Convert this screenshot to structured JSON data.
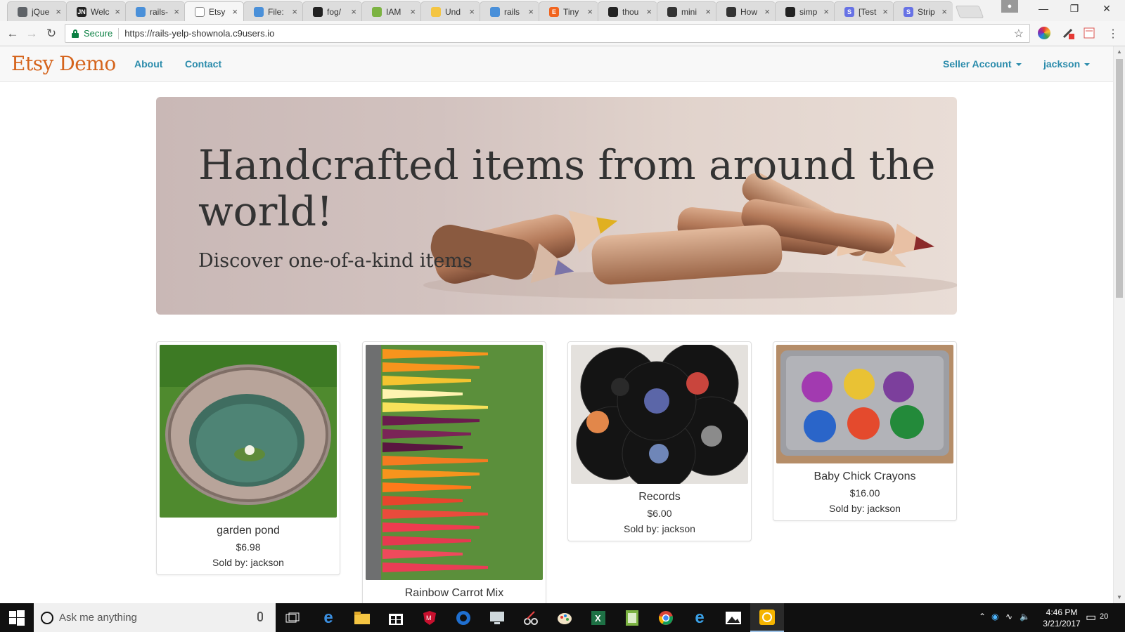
{
  "browser": {
    "tabs": [
      {
        "label": "jQue",
        "icon": "globe-icon",
        "color": "#5f6368",
        "glyph": ""
      },
      {
        "label": "Welc",
        "icon": "jn-icon",
        "color": "#222222",
        "glyph": "JN"
      },
      {
        "label": "rails-",
        "icon": "cloud9-icon",
        "color": "#4a90d9",
        "glyph": ""
      },
      {
        "label": "Etsy",
        "icon": "page-icon",
        "color": "#ffffff",
        "glyph": "",
        "active": true
      },
      {
        "label": "File:",
        "icon": "pencil-icon",
        "color": "#4a90d9",
        "glyph": ""
      },
      {
        "label": "fog/",
        "icon": "github-icon",
        "color": "#222222",
        "glyph": ""
      },
      {
        "label": "IAM",
        "icon": "pin-icon",
        "color": "#7cb342",
        "glyph": ""
      },
      {
        "label": "Und",
        "icon": "box-icon",
        "color": "#f4c542",
        "glyph": ""
      },
      {
        "label": "rails",
        "icon": "cloud9-icon",
        "color": "#4a90d9",
        "glyph": ""
      },
      {
        "label": "Tiny",
        "icon": "etsy-icon",
        "color": "#f1641e",
        "glyph": "E"
      },
      {
        "label": "thou",
        "icon": "github-icon",
        "color": "#222222",
        "glyph": ""
      },
      {
        "label": "mini",
        "icon": "camera-icon",
        "color": "#333333",
        "glyph": ""
      },
      {
        "label": "How",
        "icon": "chart-icon",
        "color": "#333333",
        "glyph": ""
      },
      {
        "label": "simp",
        "icon": "github-icon",
        "color": "#222222",
        "glyph": ""
      },
      {
        "label": "[Test",
        "icon": "stripe-icon",
        "color": "#6772e5",
        "glyph": "S"
      },
      {
        "label": "Strip",
        "icon": "stripe-icon",
        "color": "#6772e5",
        "glyph": "S"
      }
    ],
    "secure_label": "Secure",
    "url": "https://rails-yelp-shownola.c9users.io"
  },
  "site": {
    "brand": "Etsy Demo",
    "nav": {
      "about": "About",
      "contact": "Contact",
      "seller": "Seller Account",
      "user": "jackson"
    },
    "colors": {
      "brand": "#d5641c",
      "link": "#2a8bab"
    }
  },
  "hero": {
    "title": "Handcrafted items from around the world!",
    "subtitle": "Discover one-of-a-kind items"
  },
  "products": [
    {
      "name": "garden pond",
      "price": "$6.98",
      "seller": "Sold by: jackson"
    },
    {
      "name": "Rainbow Carrot Mix",
      "price": "",
      "seller": ""
    },
    {
      "name": "Records",
      "price": "$6.00",
      "seller": "Sold by: jackson"
    },
    {
      "name": "Baby Chick Crayons",
      "price": "$16.00",
      "seller": "Sold by: jackson"
    }
  ],
  "taskbar": {
    "search_placeholder": "Ask me anything",
    "time": "4:46 PM",
    "date": "3/21/2017",
    "notification_count": "20"
  }
}
